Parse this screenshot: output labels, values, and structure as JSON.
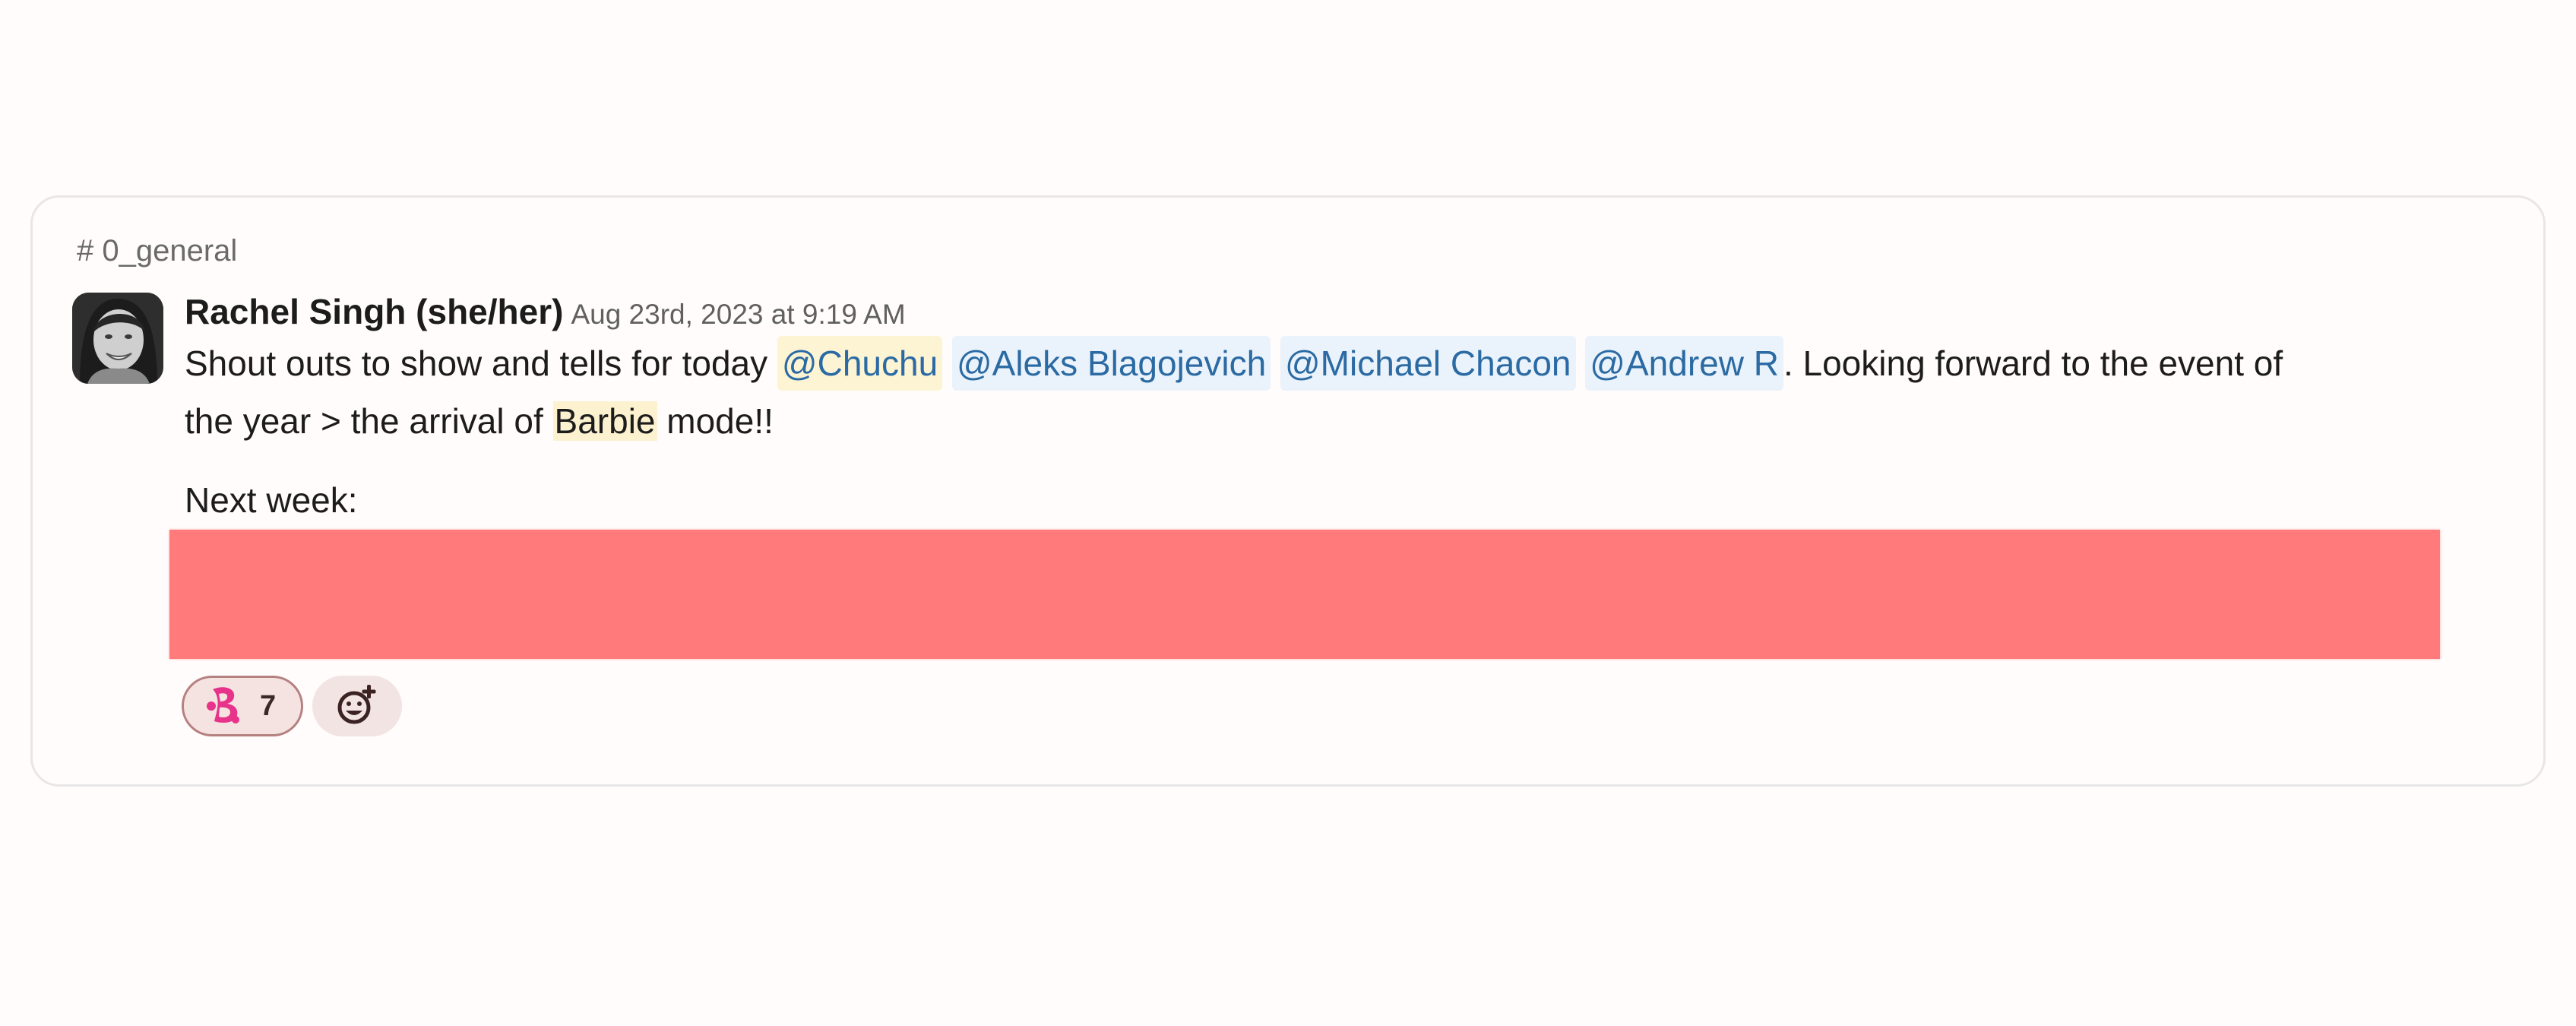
{
  "message": {
    "channel": "# 0_general",
    "author": "Rachel Singh (she/her)",
    "timestamp": "Aug 23rd, 2023 at 9:19 AM",
    "line1_prefix": "Shout outs to show and tells for today ",
    "mentions": [
      "@Chuchu",
      "@Aleks Blagojevich",
      "@Michael Chacon",
      "@Andrew R"
    ],
    "line1_suffix": ". Looking forward to the event of",
    "line2_prefix": "the year > the arrival of ",
    "highlight": "Barbie",
    "line2_suffix": " mode!!",
    "next_week": "Next week:"
  },
  "reactions": [
    {
      "emoji": "barbie-b-icon",
      "count": "7",
      "color": "#e7338a"
    }
  ],
  "add_reaction_icon": "add-reaction-icon",
  "colors": {
    "mention_text": "#2b6aa3",
    "mention_bg": "#eaf3fb",
    "self_mention_bg": "#fdf4d4",
    "redaction": "#ff7b7b"
  }
}
